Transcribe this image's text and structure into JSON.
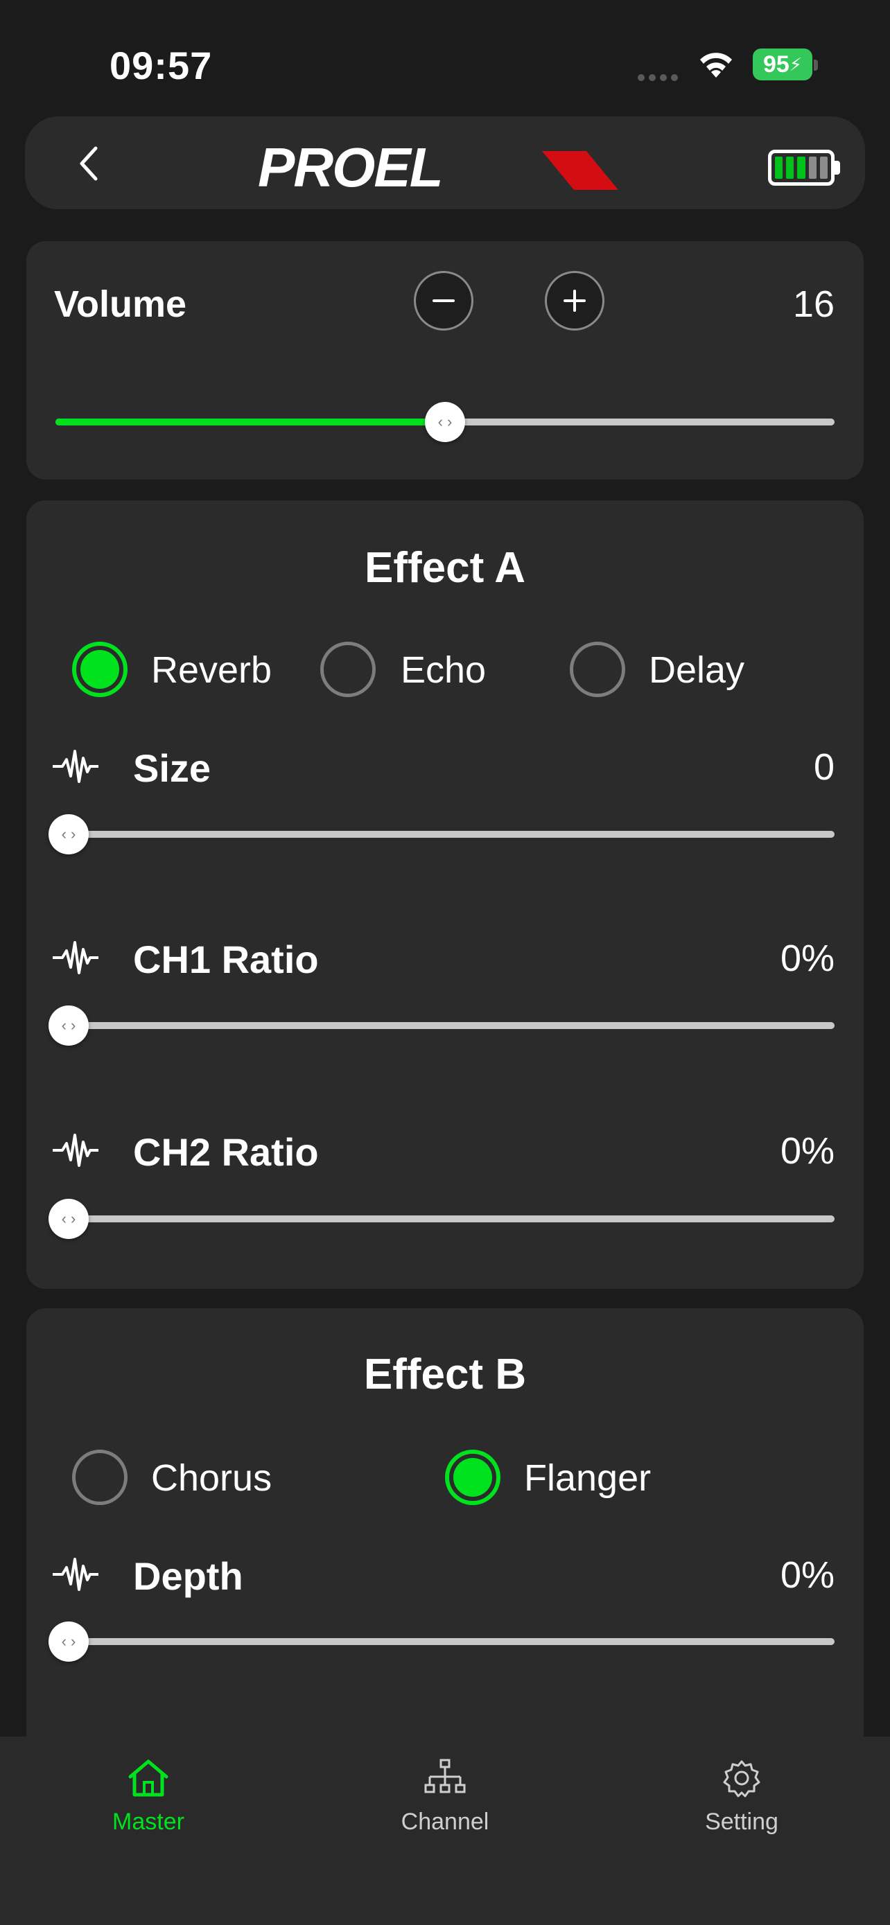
{
  "status_bar": {
    "time": "09:57",
    "battery": "95"
  },
  "header": {
    "logo_text": "PROEL",
    "colors": {
      "logo_red": "#d40d12",
      "battery_green": "#00c21a",
      "battery_gray": "#8c8c8c"
    },
    "device_battery_bars": [
      "green",
      "green",
      "green",
      "gray",
      "gray"
    ]
  },
  "volume": {
    "label": "Volume",
    "value": "16",
    "slider_fraction": 0.5
  },
  "effect_a": {
    "title": "Effect A",
    "options": [
      {
        "label": "Reverb",
        "selected": true
      },
      {
        "label": "Echo",
        "selected": false
      },
      {
        "label": "Delay",
        "selected": false
      }
    ],
    "params": [
      {
        "label": "Size",
        "value": "0",
        "fraction": 0
      },
      {
        "label": "CH1 Ratio",
        "value": "0%",
        "fraction": 0
      },
      {
        "label": "CH2 Ratio",
        "value": "0%",
        "fraction": 0
      }
    ]
  },
  "effect_b": {
    "title": "Effect B",
    "options": [
      {
        "label": "Chorus",
        "selected": false
      },
      {
        "label": "Flanger",
        "selected": true
      }
    ],
    "params": [
      {
        "label": "Depth",
        "value": "0%",
        "fraction": 0
      }
    ]
  },
  "tabbar": {
    "tabs": [
      {
        "label": "Master",
        "icon": "home-icon",
        "active": true
      },
      {
        "label": "Channel",
        "icon": "network-icon",
        "active": false
      },
      {
        "label": "Setting",
        "icon": "gear-icon",
        "active": false
      }
    ]
  },
  "colors": {
    "accent": "#00e21e",
    "background": "#1b1b1b",
    "panel": "#2b2b2b"
  }
}
